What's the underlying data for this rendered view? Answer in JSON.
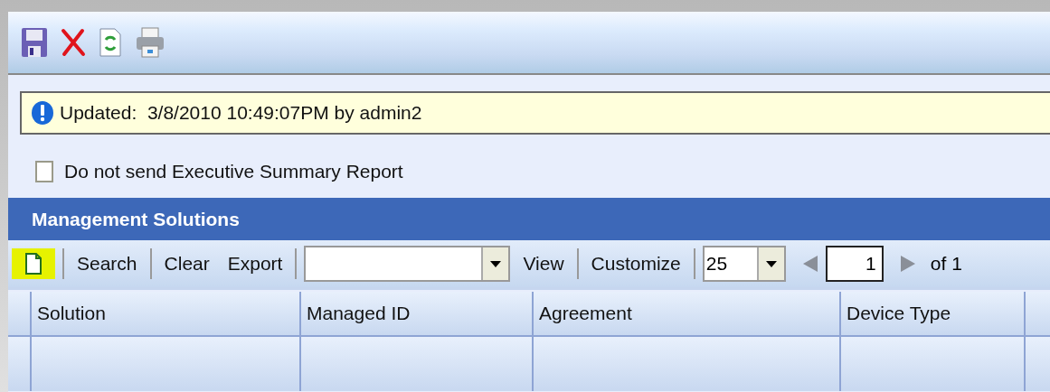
{
  "notice": {
    "text": "Updated:  3/8/2010 10:49:07PM by admin2"
  },
  "option": {
    "label": "Do not send Executive Summary Report",
    "checked": false
  },
  "section": {
    "title": "Management Solutions"
  },
  "grid_toolbar": {
    "search": "Search",
    "clear": "Clear",
    "export": "Export",
    "view": "View",
    "customize": "Customize",
    "page_size": "25",
    "page": "1",
    "page_count": "of 1"
  },
  "table": {
    "columns": [
      "Solution",
      "Managed ID",
      "Agreement",
      "Device Type"
    ]
  }
}
